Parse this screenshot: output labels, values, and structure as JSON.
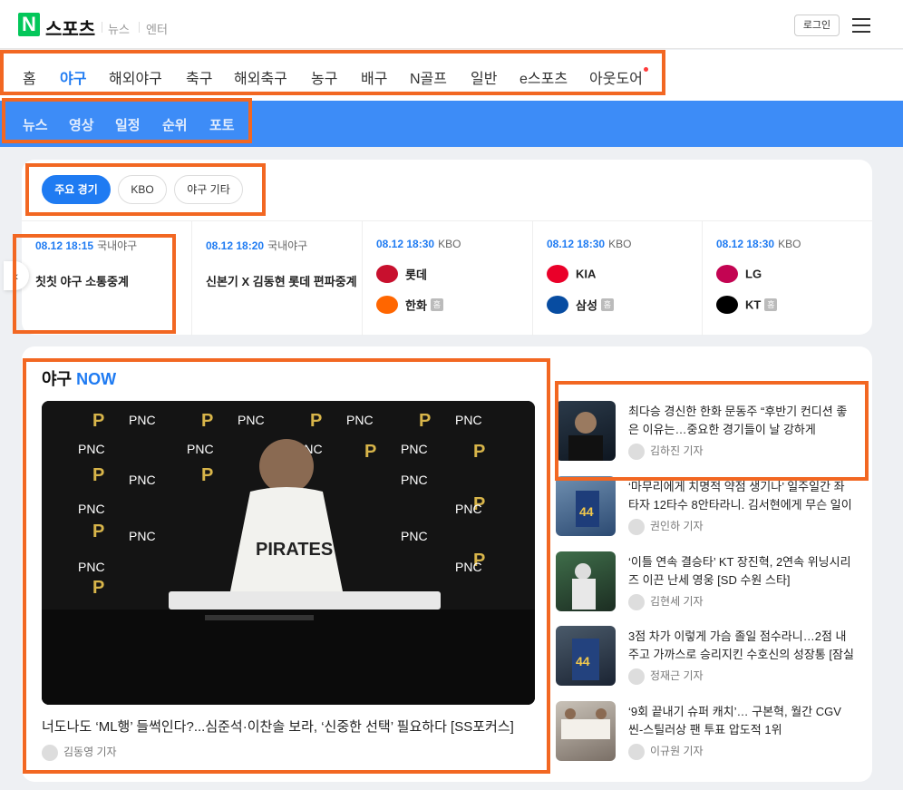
{
  "header": {
    "logo_mark": "N",
    "logo_text": "스포츠",
    "links": [
      "뉴스",
      "엔터"
    ],
    "login_label": "로그인",
    "menu_icon": "hamburger-icon"
  },
  "categories": [
    {
      "label": "홈",
      "active": false
    },
    {
      "label": "야구",
      "active": true
    },
    {
      "label": "해외야구",
      "active": false
    },
    {
      "label": "축구",
      "active": false
    },
    {
      "label": "해외축구",
      "active": false
    },
    {
      "label": "농구",
      "active": false
    },
    {
      "label": "배구",
      "active": false
    },
    {
      "label": "N골프",
      "active": false
    },
    {
      "label": "일반",
      "active": false
    },
    {
      "label": "e스포츠",
      "active": false
    },
    {
      "label": "아웃도어",
      "active": false,
      "has_new_dot": true
    }
  ],
  "subnav": [
    "뉴스",
    "영상",
    "일정",
    "순위",
    "포토"
  ],
  "filters": [
    {
      "label": "주요 경기",
      "active": true
    },
    {
      "label": "KBO",
      "active": false
    },
    {
      "label": "야구 기타",
      "active": false
    }
  ],
  "games": [
    {
      "time": "08.12 18:15",
      "league": "국내야구",
      "title": "칫칫 야구 소통중계"
    },
    {
      "time": "08.12 18:20",
      "league": "국내야구",
      "title": "신본기 X 김동현 롯데 편파중계"
    },
    {
      "time": "08.12 18:30",
      "league": "KBO",
      "away": "롯데",
      "home": "한화",
      "home_badge": "홈",
      "away_color": "#c8102e",
      "home_color": "#ff6600"
    },
    {
      "time": "08.12 18:30",
      "league": "KBO",
      "away": "KIA",
      "home": "삼성",
      "home_badge": "홈",
      "away_color": "#ea0029",
      "home_color": "#074ca1"
    },
    {
      "time": "08.12 18:30",
      "league": "KBO",
      "away": "LG",
      "home": "KT",
      "home_badge": "홈",
      "away_color": "#c30452",
      "home_color": "#000000"
    }
  ],
  "now": {
    "title_prefix": "야구",
    "title_accent": "NOW",
    "main": {
      "headline": "너도나도 ‘ML행’ 들썩인다?...심준석·이찬솔 보라, ‘신중한 선택’ 필요하다 [SS포커스]",
      "reporter": "김동영 기자",
      "photo_words": [
        "P",
        "PNC",
        "PIRATES"
      ]
    },
    "side": [
      {
        "headline": "최다승 경신한 한화 문동주 “후반기 컨디션 좋은 이유는…중요한 경기들이 날 강하게 해”[스…",
        "reporter": "김하진 기자"
      },
      {
        "headline": "‘마무리에게 치명적 약점 생기나’ 일주일간 좌타자 12타수 8안타라니. 김서현에게 무슨 일이[…",
        "reporter": "권인하 기자"
      },
      {
        "headline": "‘이틀 연속 결승타’ KT 장진혁, 2연속 위닝시리즈 이끈 난세 영웅 [SD 수원 스타]",
        "reporter": "김현세 기자"
      },
      {
        "headline": "3점 차가 이렇게 가슴 졸일 점수라니…2점 내주고 가까스로 승리지킨 수호신의 성장통 [잠실 …",
        "reporter": "정재근 기자"
      },
      {
        "headline": "‘9회 끝내기 슈퍼 캐치’… 구본혁, 월간 CGV 씬-스틸러상 팬 투표 압도적 1위",
        "reporter": "이규원 기자"
      }
    ]
  },
  "colors": {
    "accent": "#1f7bf2",
    "subnav_bg": "#3d8cf7",
    "highlight": "#f26722",
    "brand_green": "#03c75a"
  }
}
